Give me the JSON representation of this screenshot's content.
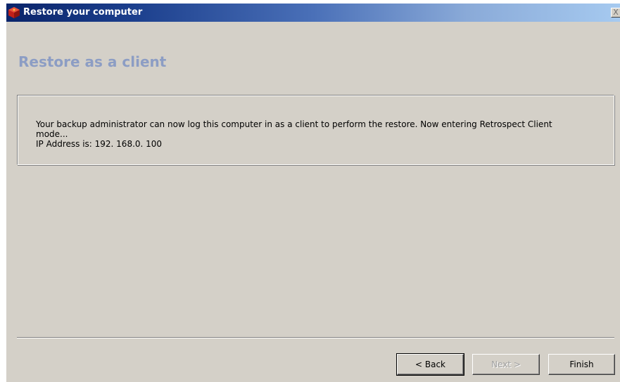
{
  "window": {
    "title": "Restore your computer",
    "close_label": "X"
  },
  "page": {
    "heading": "Restore as a client"
  },
  "message": {
    "line1": "Your backup administrator can now log this computer in as a client to perform the restore. Now entering Retrospect Client",
    "line2": "mode...",
    "ip_line": "IP Address is: 192. 168.0. 100"
  },
  "buttons": {
    "back_label": "< Back",
    "next_label": "Next >",
    "finish_label": "Finish"
  },
  "colors": {
    "titlebar_start": "#0a246a",
    "titlebar_end": "#a6caf0",
    "heading": "#8c9dc4",
    "dialog_bg": "#d4d0c8"
  },
  "icons": {
    "app": "retrospect-app-icon",
    "close": "close-icon"
  }
}
